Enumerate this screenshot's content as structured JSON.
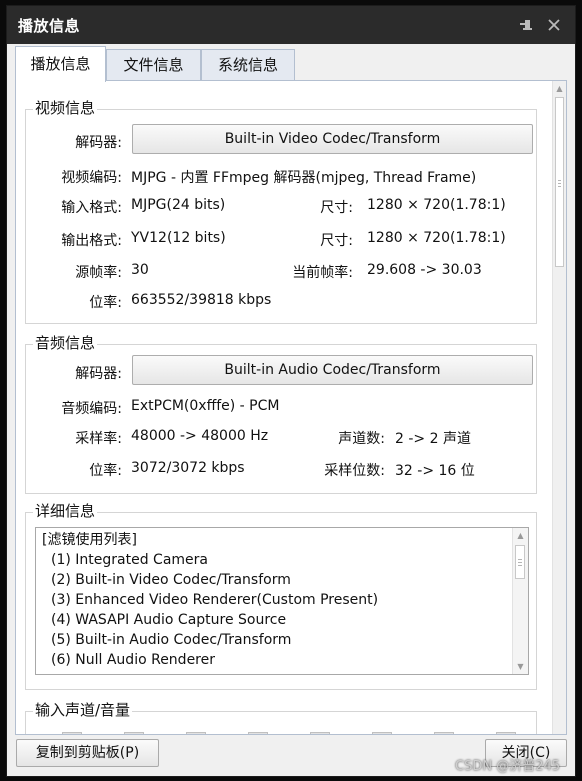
{
  "window": {
    "title": "播放信息"
  },
  "titlebar": {
    "pin_icon": "pin-icon",
    "close_icon": "close-icon"
  },
  "tabs": [
    "播放信息",
    "文件信息",
    "系统信息"
  ],
  "video": {
    "section_title": "视频信息",
    "decoder_label": "解码器:",
    "decoder_button": "Built-in Video Codec/Transform",
    "encoding_label": "视频编码:",
    "encoding_value": "MJPG - 内置 FFmpeg 解码器(mjpeg, Thread Frame)",
    "input_format_label": "输入格式:",
    "input_format_value": "MJPG(24 bits)",
    "input_size_label": "尺寸:",
    "input_size_value": "1280 × 720(1.78:1)",
    "output_format_label": "输出格式:",
    "output_format_value": "YV12(12 bits)",
    "output_size_label": "尺寸:",
    "output_size_value": "1280 × 720(1.78:1)",
    "src_fps_label": "源帧率:",
    "src_fps_value": "30",
    "cur_fps_label": "当前帧率:",
    "cur_fps_value": "29.608 -> 30.03",
    "bitrate_label": "位率:",
    "bitrate_value": "663552/39818 kbps"
  },
  "audio": {
    "section_title": "音频信息",
    "decoder_label": "解码器:",
    "decoder_button": "Built-in Audio Codec/Transform",
    "encoding_label": "音频编码:",
    "encoding_value": "ExtPCM(0xfffe) - PCM",
    "sample_rate_label": "采样率:",
    "sample_rate_value": "48000 -> 48000 Hz",
    "channels_label": "声道数:",
    "channels_value": "2 -> 2 声道",
    "bitrate_label": "位率:",
    "bitrate_value": "3072/3072 kbps",
    "bit_depth_label": "采样位数:",
    "bit_depth_value": "32 -> 16 位"
  },
  "details": {
    "section_title": "详细信息",
    "header": "[滤镜使用列表]",
    "items": [
      "(1) Integrated Camera",
      "(2) Built-in Video Codec/Transform",
      "(3) Enhanced Video Renderer(Custom Present)",
      "(4) WASAPI Audio Capture Source",
      "(5) Built-in Audio Codec/Transform",
      "(6) Null Audio Renderer"
    ]
  },
  "volume": {
    "section_title": "输入声道/音量",
    "channel_count": 8
  },
  "footer": {
    "copy_button": "复制到剪贴板(P)",
    "close_button": "关闭(C)"
  },
  "watermark": "CSDN @济普245"
}
